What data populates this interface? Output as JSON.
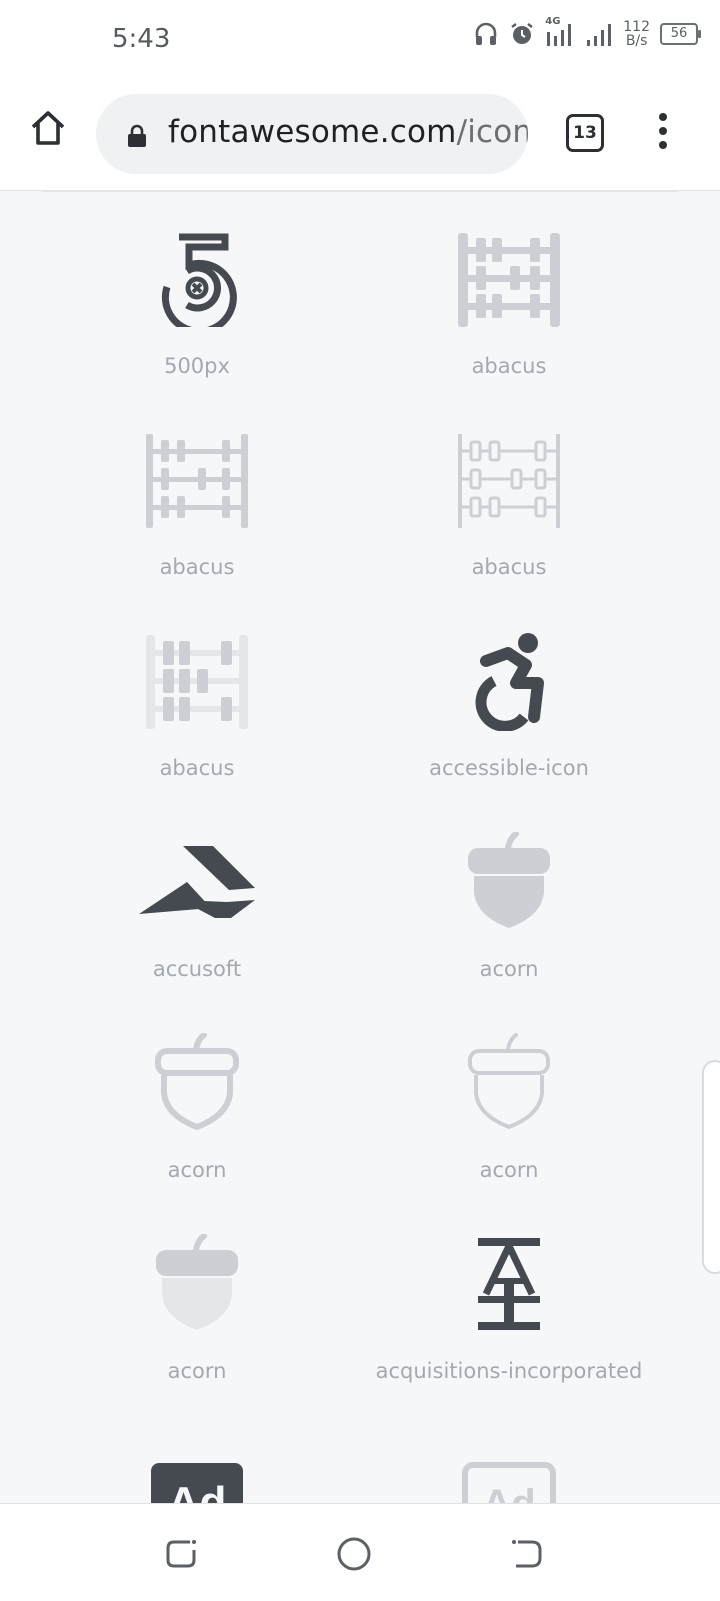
{
  "status": {
    "time": "5:43",
    "network": "4G",
    "speed_value": "112",
    "speed_unit": "B/s",
    "battery": "56",
    "icons": [
      "headphones-icon",
      "alarm-icon",
      "signal-icon",
      "signal-icon"
    ]
  },
  "browser": {
    "url_host": "fontawesome.com",
    "url_path": "/icons",
    "tab_count": "13",
    "icons": [
      "home-icon",
      "lock-icon",
      "menu-icon"
    ]
  },
  "icons": [
    {
      "label": "500px",
      "icon": "500px-icon",
      "style": "dark"
    },
    {
      "label": "abacus",
      "icon": "abacus-icon",
      "style": "light"
    },
    {
      "label": "abacus",
      "icon": "abacus-icon",
      "style": "light"
    },
    {
      "label": "abacus",
      "icon": "abacus-icon",
      "style": "outline"
    },
    {
      "label": "abacus",
      "icon": "abacus-icon",
      "style": "duotone"
    },
    {
      "label": "accessible-icon",
      "icon": "accessible-icon",
      "style": "dark"
    },
    {
      "label": "accusoft",
      "icon": "accusoft-icon",
      "style": "dark"
    },
    {
      "label": "acorn",
      "icon": "acorn-icon",
      "style": "solid-light"
    },
    {
      "label": "acorn",
      "icon": "acorn-icon",
      "style": "outline"
    },
    {
      "label": "acorn",
      "icon": "acorn-icon",
      "style": "outline"
    },
    {
      "label": "acorn",
      "icon": "acorn-icon",
      "style": "duotone"
    },
    {
      "label": "acquisitions-incorporated",
      "icon": "acquisitions-incorporated-icon",
      "style": "dark"
    }
  ],
  "colors": {
    "dark_icon": "#454a50",
    "light_icon": "#ccd0d5",
    "background": "#f6f7f9"
  },
  "navbar": [
    "recents-icon",
    "home-circle-icon",
    "back-icon"
  ]
}
